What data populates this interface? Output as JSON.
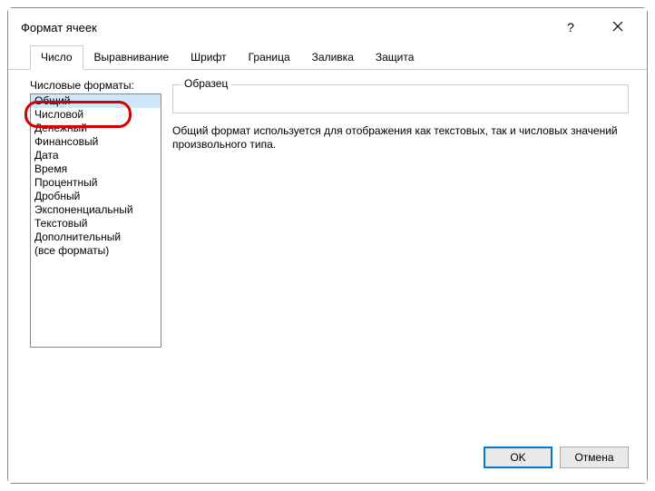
{
  "dialog": {
    "title": "Формат ячеек"
  },
  "tabs": [
    {
      "label": "Число",
      "active": true
    },
    {
      "label": "Выравнивание",
      "active": false
    },
    {
      "label": "Шрифт",
      "active": false
    },
    {
      "label": "Граница",
      "active": false
    },
    {
      "label": "Заливка",
      "active": false
    },
    {
      "label": "Защита",
      "active": false
    }
  ],
  "formatsList": {
    "label": "Числовые форматы:",
    "items": [
      "Общий",
      "Числовой",
      "Денежный",
      "Финансовый",
      "Дата",
      "Время",
      "Процентный",
      "Дробный",
      "Экспоненциальный",
      "Текстовый",
      "Дополнительный",
      "(все форматы)"
    ],
    "selectedIndex": 0
  },
  "sample": {
    "label": "Образец"
  },
  "description": "Общий формат используется для отображения как текстовых, так и числовых значений произвольного типа.",
  "buttons": {
    "ok": "OK",
    "cancel": "Отмена"
  }
}
